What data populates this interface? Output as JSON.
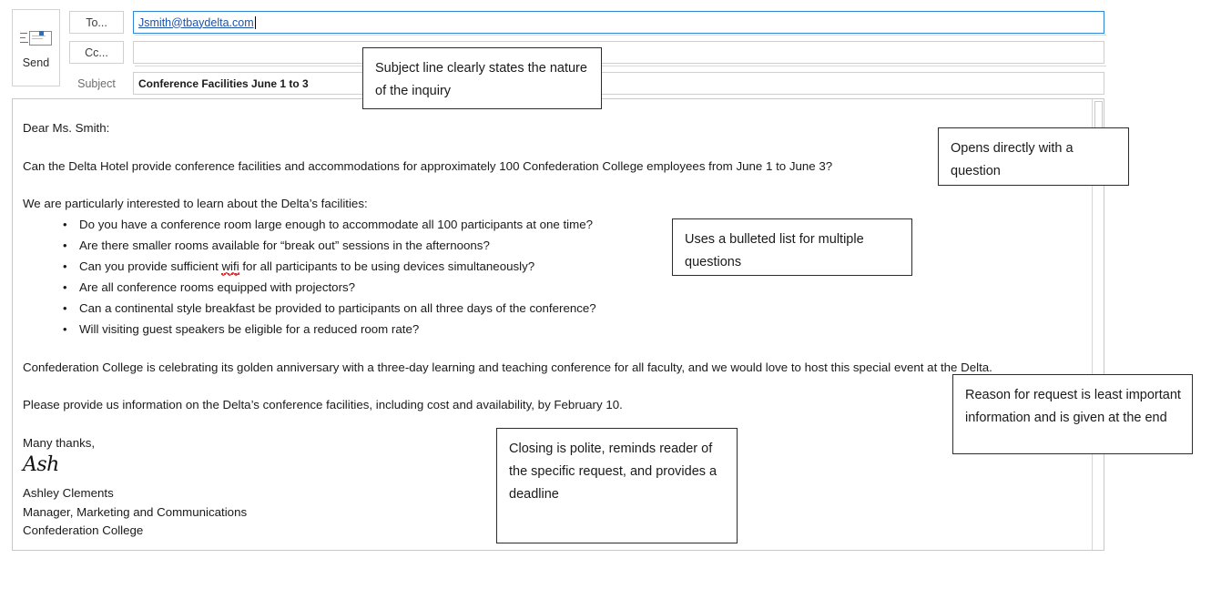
{
  "compose": {
    "send_button": {
      "label": "Send",
      "icon": "envelope-send-icon"
    },
    "fields": {
      "to_label": "To...",
      "to_value": "Jsmith@tbaydelta.com",
      "cc_label": "Cc...",
      "cc_value": "",
      "subject_label": "Subject",
      "subject_value": "Conference Facilities June 1 to 3"
    },
    "colors": {
      "to_field_focus_border": "#2e86d6",
      "recipient_link": "#1d52a8",
      "field_border": "#cfcfcf",
      "spellcheck_underline": "#e03030"
    }
  },
  "email_body": {
    "salutation": "Dear Ms. Smith:",
    "opening_question": "Can the Delta Hotel provide conference facilities and accommodations for approximately 100 Confederation College employees from June 1 to June 3?",
    "list_intro": "We are particularly interested to learn about the Delta’s facilities:",
    "questions": [
      "Do you have a conference room large enough to accommodate all 100 participants at one time?",
      "Are there smaller rooms available for “break out” sessions in the afternoons?",
      "Can you provide sufficient wifi for all participants to be using devices simultaneously?",
      "Are all conference rooms equipped with projectors?",
      "Can a continental style breakfast be provided to participants on all three days of the conference?",
      "Will visiting guest speakers be eligible for a reduced room rate?"
    ],
    "misspelled_word": "wifi",
    "question_3_before": "Can you provide sufficient ",
    "question_3_after": " for all participants to be using devices simultaneously?",
    "reason_paragraph": "Confederation College is celebrating its golden anniversary with a three-day learning and teaching conference for all faculty, and we would love to host this special event at the Delta.",
    "request_paragraph": "Please provide us information on the Delta’s conference facilities, including cost and availability, by February 10.",
    "closing": "Many thanks,",
    "signature_script": "Ash",
    "signer_name": "Ashley Clements",
    "signer_title": "Manager, Marketing and Communications",
    "signer_org": "Confederation College"
  },
  "annotations": {
    "subject_note": "Subject line clearly states the nature of the inquiry",
    "opening_note": "Opens directly with a question",
    "bullets_note": "Uses a bulleted list for multiple questions",
    "reason_note": "Reason for request is least important information and is given at the end",
    "closing_note": "Closing is polite, reminds reader of the specific request, and provides a deadline"
  }
}
